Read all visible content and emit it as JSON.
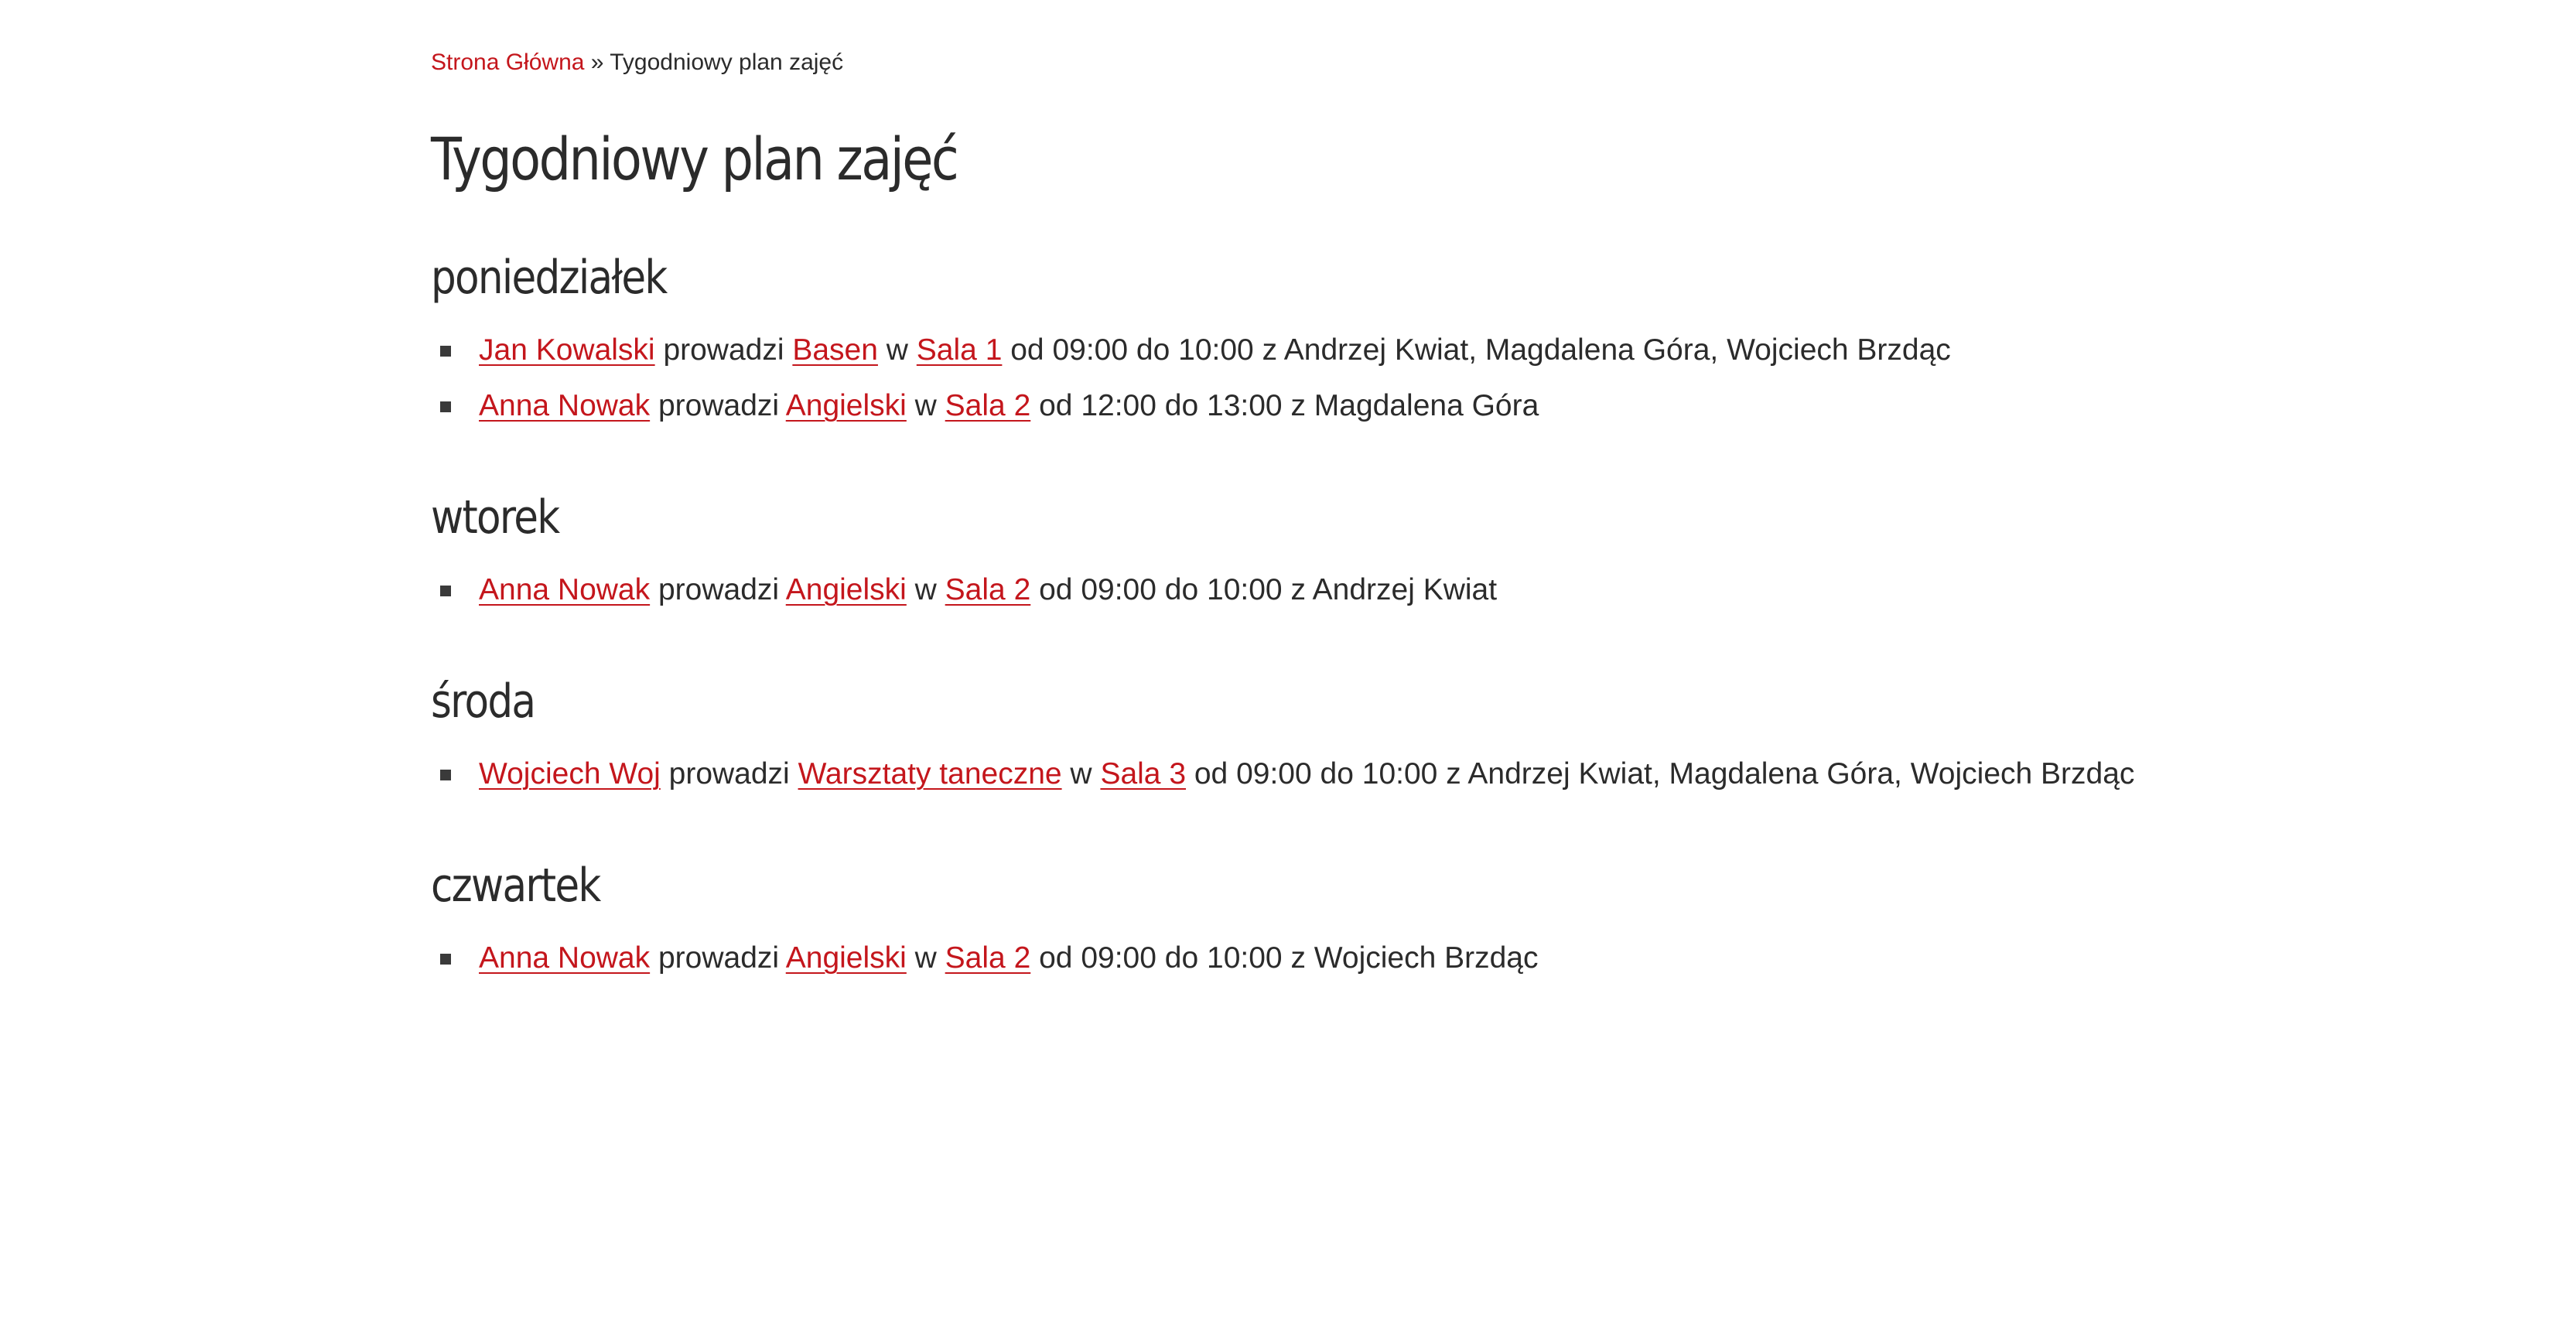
{
  "breadcrumb": {
    "home": "Strona Główna",
    "separator": " » ",
    "current": "Tygodniowy plan zajęć"
  },
  "title": "Tygodniowy plan zajęć",
  "words": {
    "leads": " prowadzi ",
    "in": " w ",
    "from": " od ",
    "to": " do ",
    "with": " z "
  },
  "colors": {
    "link": "#c4161c",
    "text": "#2b2b2b",
    "bullet": "#3a3a3a"
  },
  "days": [
    {
      "name": "poniedziałek",
      "entries": [
        {
          "teacher": "Jan Kowalski",
          "activity": "Basen",
          "room": "Sala 1",
          "start": "09:00",
          "end": "10:00",
          "participants": "Andrzej Kwiat, Magdalena Góra, Wojciech Brzdąc"
        },
        {
          "teacher": "Anna Nowak",
          "activity": "Angielski",
          "room": "Sala 2",
          "start": "12:00",
          "end": "13:00",
          "participants": "Magdalena Góra"
        }
      ]
    },
    {
      "name": "wtorek",
      "entries": [
        {
          "teacher": "Anna Nowak",
          "activity": "Angielski",
          "room": "Sala 2",
          "start": "09:00",
          "end": "10:00",
          "participants": "Andrzej Kwiat"
        }
      ]
    },
    {
      "name": "środa",
      "entries": [
        {
          "teacher": "Wojciech Woj",
          "activity": "Warsztaty taneczne",
          "room": "Sala 3",
          "start": "09:00",
          "end": "10:00",
          "participants": "Andrzej Kwiat, Magdalena Góra, Wojciech Brzdąc"
        }
      ]
    },
    {
      "name": "czwartek",
      "entries": [
        {
          "teacher": "Anna Nowak",
          "activity": "Angielski",
          "room": "Sala 2",
          "start": "09:00",
          "end": "10:00",
          "participants": "Wojciech Brzdąc"
        }
      ]
    }
  ]
}
